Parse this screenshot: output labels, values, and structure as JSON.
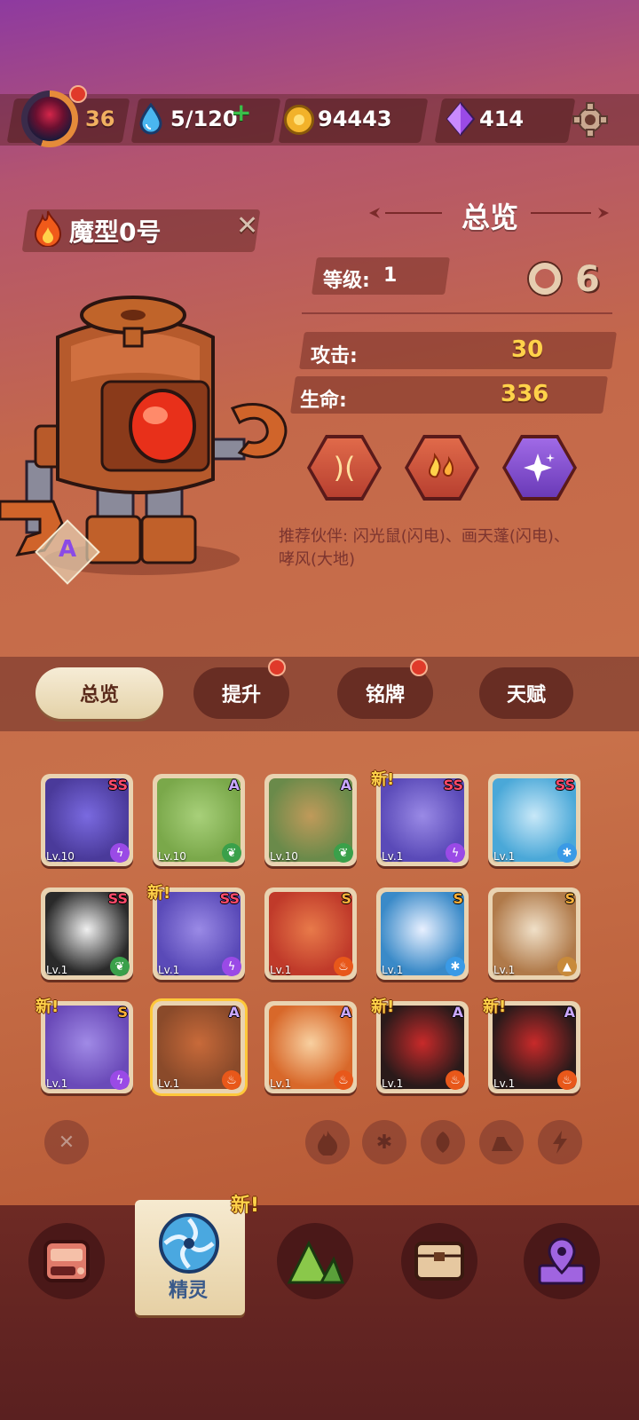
{
  "top_bar": {
    "level": "36",
    "energy": "5/120",
    "coins": "94443",
    "gems": "414"
  },
  "character": {
    "name": "魔型0号",
    "grade": "A"
  },
  "overview": {
    "title": "总览",
    "level_label": "等级:",
    "level_value": "1",
    "attack_label": "攻击:",
    "attack_value": "30",
    "hp_label": "生命:",
    "hp_value": "336",
    "recommend_text": "推荐伙伴: 闪光鼠(闪电)、画天蓬(闪电)、哮风(大地)"
  },
  "tabs": [
    {
      "label": "总览"
    },
    {
      "label": "提升"
    },
    {
      "label": "铭牌"
    },
    {
      "label": "天赋"
    }
  ],
  "spirits": [
    {
      "level": "Lv.10",
      "rank": "SS",
      "element": "lightning",
      "is_new": false
    },
    {
      "level": "Lv.10",
      "rank": "A",
      "element": "leaf",
      "is_new": false
    },
    {
      "level": "Lv.10",
      "rank": "A",
      "element": "leaf",
      "is_new": false
    },
    {
      "level": "Lv.1",
      "rank": "SS",
      "element": "lightning",
      "is_new": true,
      "new_label": "新!"
    },
    {
      "level": "Lv.1",
      "rank": "SS",
      "element": "ice",
      "is_new": false
    },
    {
      "level": "Lv.1",
      "rank": "SS",
      "element": "leaf",
      "is_new": false
    },
    {
      "level": "Lv.1",
      "rank": "SS",
      "element": "lightning",
      "is_new": true,
      "new_label": "新!"
    },
    {
      "level": "Lv.1",
      "rank": "S",
      "element": "fire",
      "is_new": false
    },
    {
      "level": "Lv.1",
      "rank": "S",
      "element": "ice",
      "is_new": false
    },
    {
      "level": "Lv.1",
      "rank": "S",
      "element": "earth",
      "is_new": false
    },
    {
      "level": "Lv.1",
      "rank": "S",
      "element": "lightning",
      "is_new": true,
      "new_label": "新!"
    },
    {
      "level": "Lv.1",
      "rank": "A",
      "element": "fire",
      "is_new": false
    },
    {
      "level": "Lv.1",
      "rank": "A",
      "element": "fire",
      "is_new": false
    },
    {
      "level": "Lv.1",
      "rank": "A",
      "element": "fire",
      "is_new": true,
      "new_label": "新!"
    },
    {
      "level": "Lv.1",
      "rank": "A",
      "element": "fire",
      "is_new": true,
      "new_label": "新!"
    }
  ],
  "nav": {
    "active_label": "精灵",
    "new_label": "新!"
  },
  "colors": {
    "gold_text": "#ffd24a",
    "rank_ss": "#ff4a6a",
    "rank_s": "#ffb23a",
    "rank_a": "#c9a7ff"
  }
}
